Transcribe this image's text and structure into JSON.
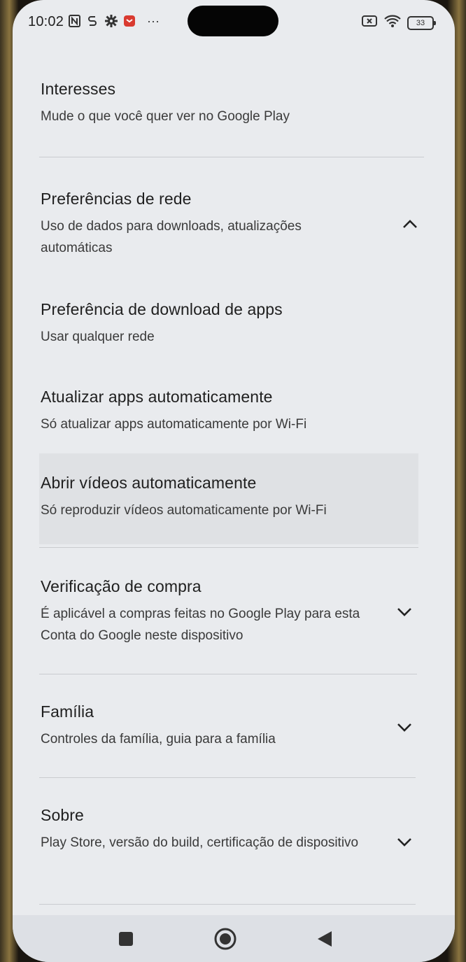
{
  "status_bar": {
    "time": "10:02",
    "battery": "33"
  },
  "settings": [
    {
      "title": "Interesses",
      "subtitle": "Mude o que você quer ver no Google Play"
    },
    {
      "title": "Preferências de rede",
      "subtitle": "Uso de dados para downloads, atualizações automáticas",
      "chevron": "chevron-up-icon"
    },
    {
      "title": "Preferência de download de apps",
      "subtitle": "Usar qualquer rede"
    },
    {
      "title": "Atualizar apps automaticamente",
      "subtitle": "Só atualizar apps automaticamente por Wi-Fi"
    },
    {
      "title": "Abrir vídeos automaticamente",
      "subtitle": "Só reproduzir vídeos automaticamente por Wi-Fi"
    },
    {
      "title": "Verificação de compra",
      "subtitle": "É aplicável a compras feitas no Google Play para esta Conta do Google neste dispositivo",
      "chevron": "chevron-down-icon"
    },
    {
      "title": "Família",
      "subtitle": "Controles da família, guia para a família",
      "chevron": "chevron-down-icon"
    },
    {
      "title": "Sobre",
      "subtitle": "Play Store, versão do build, certificação de dispositivo",
      "chevron": "chevron-down-icon"
    }
  ],
  "nav_bar": {
    "buttons": [
      "recents-icon",
      "home-icon",
      "back-icon"
    ]
  }
}
